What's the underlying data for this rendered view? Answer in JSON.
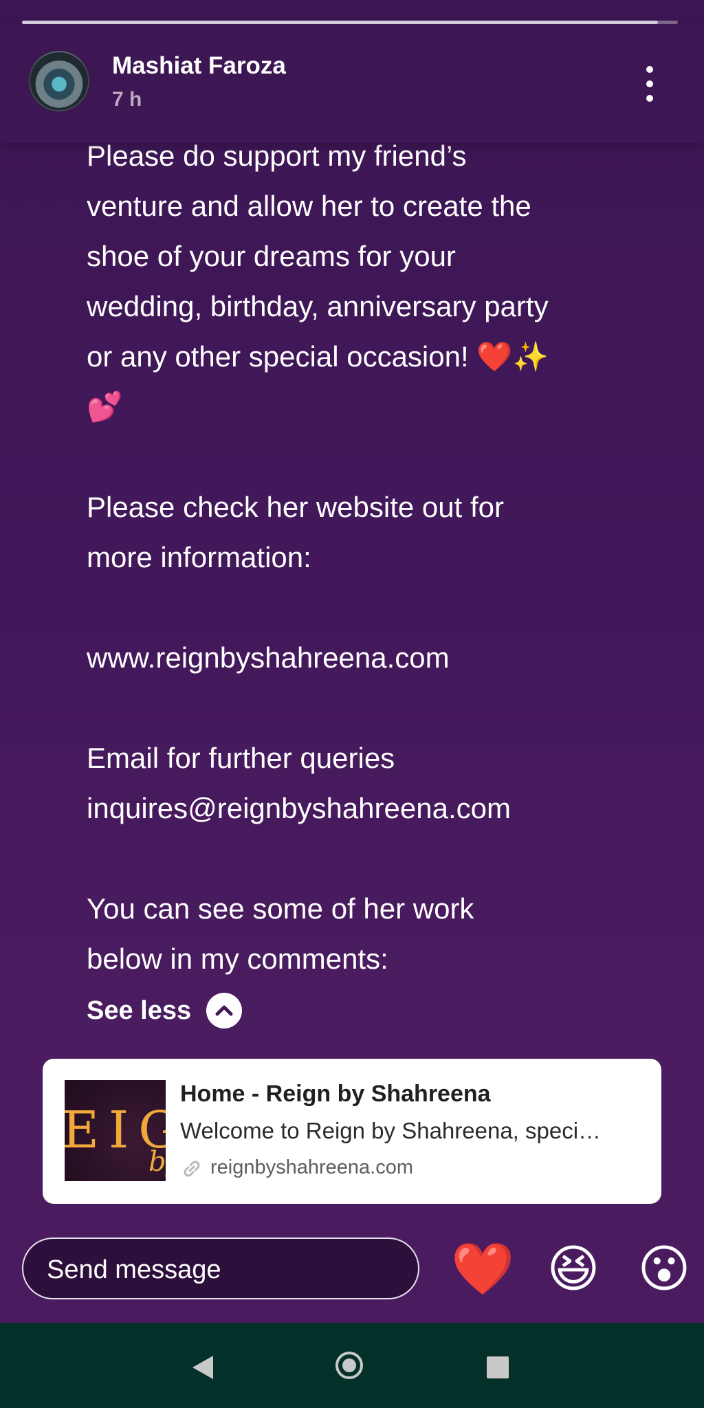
{
  "story": {
    "progress": 0.97,
    "poster_name": "Mashiat Faroza",
    "time": "7 h"
  },
  "post": {
    "lines": [
      "Please do support my friend’s",
      "venture and allow her to create the",
      "shoe of your dreams for your",
      "wedding, birthday, anniversary party",
      "or any other special occasion! ❤️✨",
      "💕",
      "",
      "Please check her website out for",
      "more information:",
      "",
      "www.reignbyshahreena.com",
      "",
      "Email for further queries",
      "inquires@reignbyshahreena.com",
      "",
      "You can see some of her work",
      "below in my comments:"
    ],
    "see_less": "See less"
  },
  "link_preview": {
    "title": "Home - Reign by Shahreena",
    "description": "Welcome to Reign by Shahreena, speci…",
    "domain": "reignbyshahreena.com",
    "thumb_text": "EIGN",
    "thumb_script": "by"
  },
  "composer": {
    "placeholder": "Send message",
    "reactions": [
      "❤️",
      "😆",
      "😮"
    ]
  },
  "colors": {
    "background": "#42185a",
    "header": "#3d1654",
    "navbar": "#04302a"
  },
  "icons": {
    "more": "more-vertical-icon",
    "see_less": "chevron-up-icon",
    "link": "link-icon",
    "back": "back-triangle-icon",
    "home": "home-circle-icon",
    "recents": "recents-square-icon"
  }
}
